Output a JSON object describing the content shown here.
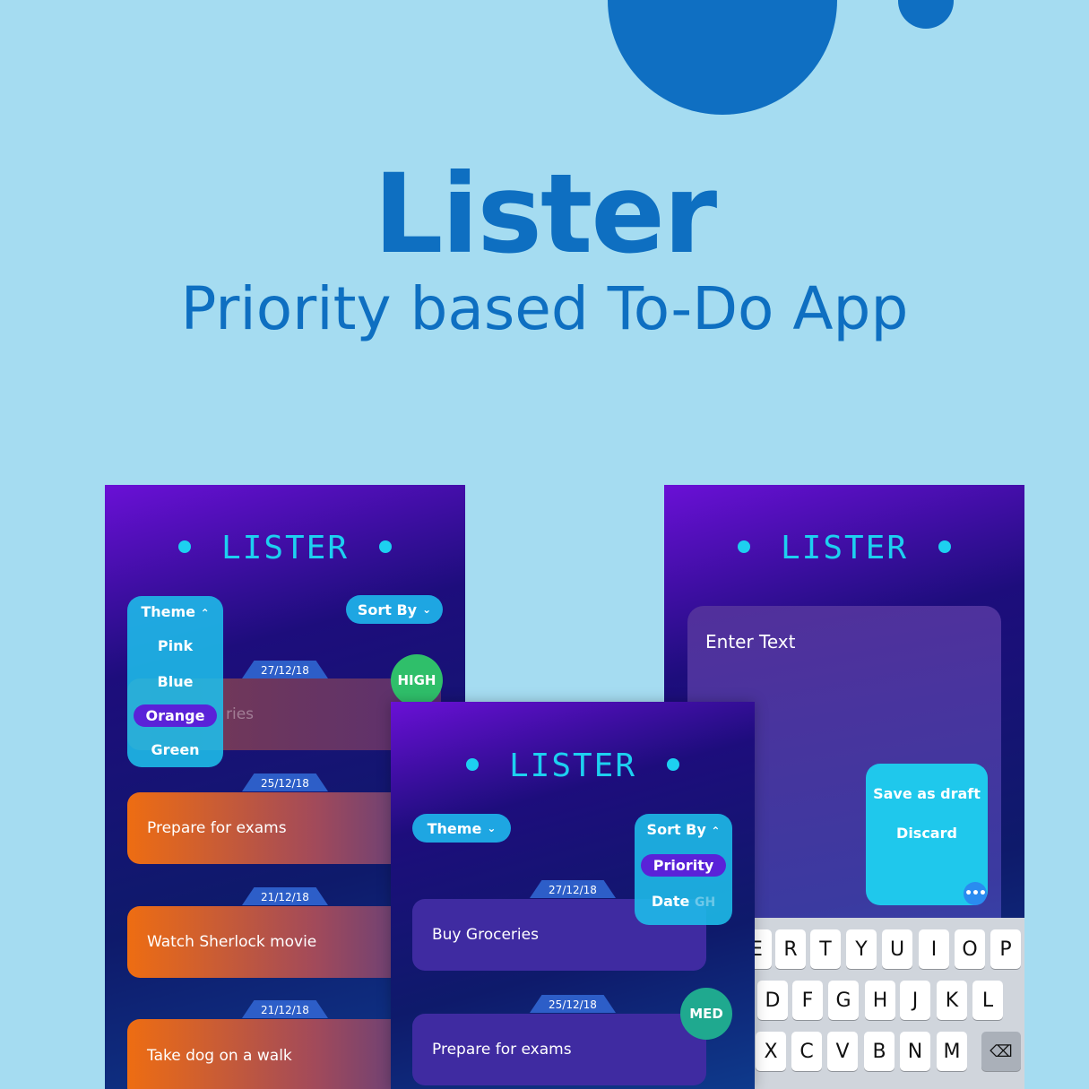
{
  "hero": {
    "title": "Lister",
    "subtitle": "Priority based To-Do App"
  },
  "colors": {
    "background": "#a5dcf1",
    "brand_blue": "#0e6fc1",
    "logo_cyan": "#1dd0f0",
    "high": "#2fbf6a",
    "med": "#1fa98f",
    "selected": "#5a22d8"
  },
  "screen_left": {
    "logo": "LISTER",
    "theme_menu": {
      "label": "Theme",
      "chevron_icon": "chevron-up-icon",
      "options": [
        "Pink",
        "Blue",
        "Orange",
        "Green"
      ],
      "selected": "Orange"
    },
    "sort_button": {
      "label": "Sort By",
      "chevron_icon": "chevron-down-icon"
    },
    "tasks": [
      {
        "date": "27/12/18",
        "text": "ries",
        "priority": "HIGH"
      },
      {
        "date": "25/12/18",
        "text": "Prepare for exams"
      },
      {
        "date": "21/12/18",
        "text": "Watch Sherlock movie"
      },
      {
        "date": "21/12/18",
        "text": "Take dog on a walk"
      }
    ]
  },
  "screen_mid": {
    "logo": "LISTER",
    "theme_button": {
      "label": "Theme",
      "chevron_icon": "chevron-down-icon"
    },
    "sort_menu": {
      "label": "Sort By",
      "chevron_icon": "chevron-up-icon",
      "options": [
        "Priority",
        "Date"
      ],
      "selected": "Priority",
      "behind_text": "GH"
    },
    "tasks": [
      {
        "date": "27/12/18",
        "text": "Buy Groceries"
      },
      {
        "date": "25/12/18",
        "text": "Prepare for exams",
        "priority": "MED"
      }
    ]
  },
  "screen_right": {
    "logo": "LISTER",
    "editor_placeholder": "Enter Text",
    "menu": {
      "save_draft": "Save as draft",
      "discard": "Discard"
    },
    "more_icon": "more-horizontal-icon",
    "keyboard": {
      "row1": [
        "E",
        "R",
        "T",
        "Y",
        "U",
        "I",
        "O",
        "P"
      ],
      "row2": [
        "D",
        "F",
        "G",
        "H",
        "J",
        "K",
        "L"
      ],
      "row3": [
        "X",
        "C",
        "V",
        "B",
        "N",
        "M"
      ],
      "delete_icon": "backspace-icon",
      "delete_glyph": "⌫"
    }
  }
}
